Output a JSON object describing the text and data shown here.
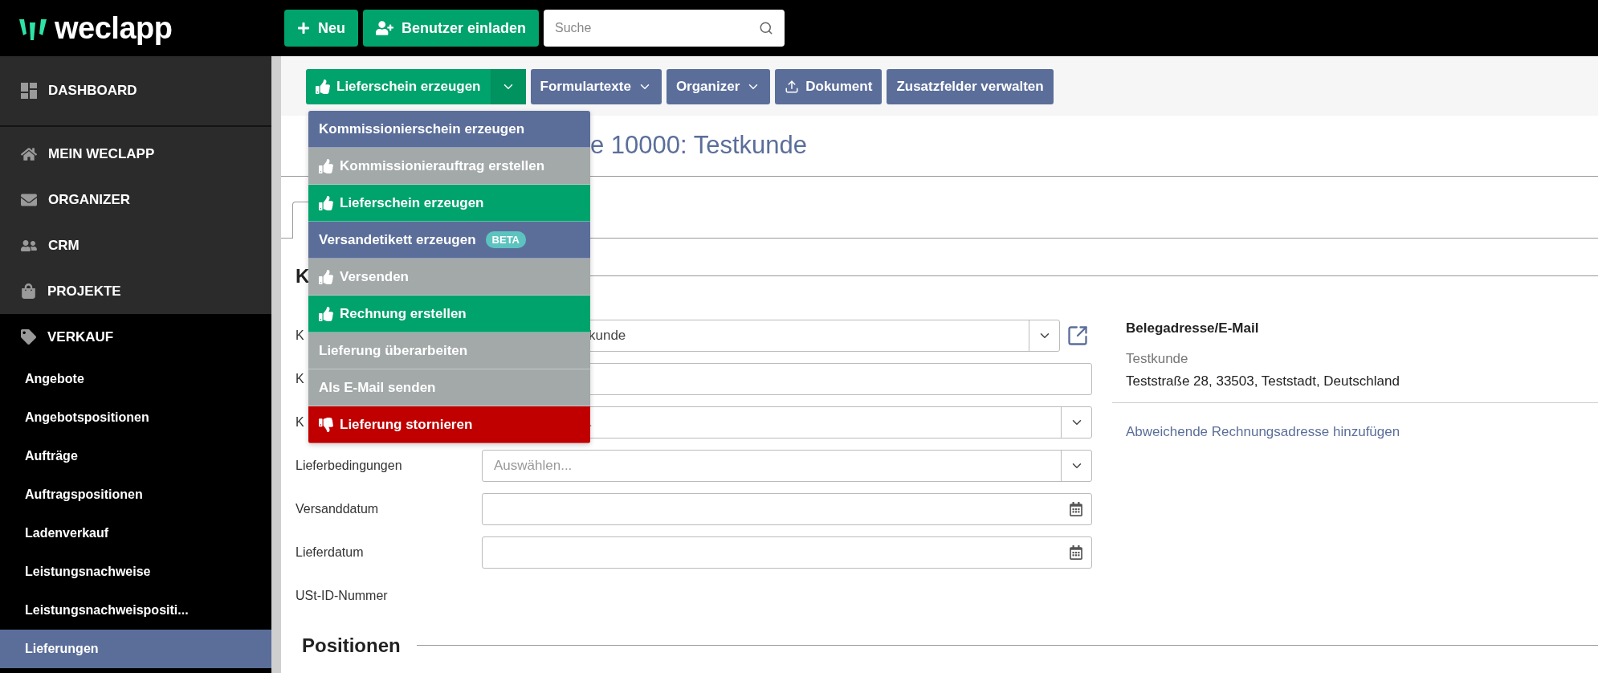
{
  "header": {
    "logo": "weclapp",
    "buttons": [
      {
        "label": "Neu",
        "kind": "new"
      },
      {
        "label": "Benutzer einladen",
        "kind": "invite"
      }
    ],
    "search": {
      "placeholder": "Suche"
    }
  },
  "sidebar": {
    "items": [
      {
        "label": "DASHBOARD"
      },
      {
        "label": "MEIN WECLAPP"
      },
      {
        "label": "ORGANIZER"
      },
      {
        "label": "CRM"
      },
      {
        "label": "PROJEKTE"
      }
    ],
    "group": {
      "label": "VERKAUF",
      "children": [
        {
          "label": "Angebote",
          "selected": false
        },
        {
          "label": "Angebotspositionen",
          "selected": false
        },
        {
          "label": "Aufträge",
          "selected": false
        },
        {
          "label": "Auftragspositionen",
          "selected": false
        },
        {
          "label": "Ladenverkauf",
          "selected": false
        },
        {
          "label": "Leistungsnachweise",
          "selected": false
        },
        {
          "label": "Leistungsnachweispositi...",
          "selected": false
        },
        {
          "label": "Lieferungen",
          "selected": true
        }
      ]
    }
  },
  "toolbar": {
    "buttons": [
      {
        "label": "Lieferschein erzeugen",
        "kind": "split",
        "expanded": true
      },
      {
        "label": "Formulartexte",
        "kind": "dropdown"
      },
      {
        "label": "Organizer",
        "kind": "dropdown"
      },
      {
        "label": "Dokument",
        "kind": "upload"
      },
      {
        "label": "Zusatzfelder verwalten",
        "kind": "plain"
      }
    ]
  },
  "menu": {
    "items": [
      {
        "label": "Kommissionierschein erzeugen",
        "kind": "primary",
        "disabled": false
      },
      {
        "label": "Kommissionierauftrag erstellen",
        "kind": "success",
        "disabled": true
      },
      {
        "label": "Lieferschein erzeugen",
        "kind": "success",
        "disabled": false
      },
      {
        "label": "Versandetikett erzeugen",
        "kind": "primary",
        "disabled": false,
        "badge": "BETA"
      },
      {
        "label": "Versenden",
        "kind": "success",
        "disabled": true
      },
      {
        "label": "Rechnung erstellen",
        "kind": "success",
        "disabled": false
      },
      {
        "label": "Lieferung überarbeiten",
        "kind": "primary",
        "disabled": true
      },
      {
        "label": "Als E-Mail senden",
        "kind": "primary",
        "disabled": true
      },
      {
        "label": "Lieferung stornieren",
        "kind": "danger",
        "disabled": false
      }
    ]
  },
  "title": "e 10000: Testkunde",
  "section": {
    "heading": "K",
    "fields": [
      {
        "label": "K",
        "kind": "select",
        "value": "kunde",
        "external_link": true
      },
      {
        "label": "K",
        "kind": "input"
      },
      {
        "label": "K",
        "kind": "select",
        "placeholder": "."
      },
      {
        "label": "Lieferbedingungen",
        "kind": "select",
        "placeholder": "Auswählen..."
      },
      {
        "label": "Versanddatum",
        "kind": "date"
      },
      {
        "label": "Lieferdatum",
        "kind": "date"
      },
      {
        "label": "USt-ID-Nummer",
        "kind": "text"
      }
    ]
  },
  "address": {
    "heading": "Belegadresse/E-Mail",
    "name": "Testkunde",
    "line": "Teststraße 28, 33503, Teststadt, Deutschland",
    "link": "Abweichende Rechnungsadresse hinzufügen"
  },
  "positions": {
    "heading": "Positionen"
  }
}
